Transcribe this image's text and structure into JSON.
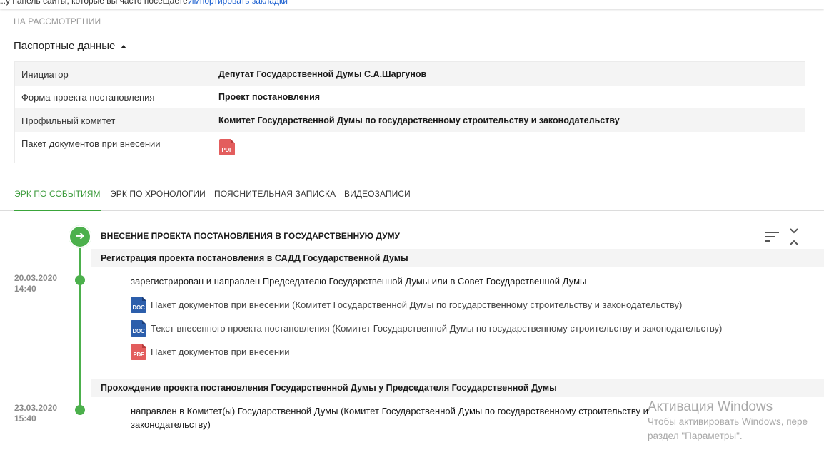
{
  "browser": {
    "bookmarks_hint": "...у панель сайты, которые вы часто посещаете.",
    "import_bookmarks_link": "Импортировать закладки"
  },
  "status_label": "НА РАССМОТРЕНИИ",
  "passport": {
    "toggle_label": "Паспортные данные",
    "rows": [
      {
        "label": "Инициатор",
        "value": "Депутат Государственной Думы С.А.Шаргунов"
      },
      {
        "label": "Форма проекта постановления",
        "value": "Проект постановления"
      },
      {
        "label": "Профильный комитет",
        "value": "Комитет Государственной Думы по государственному строительству и законодательству"
      },
      {
        "label": "Пакет документов при внесении",
        "icon": "pdf-icon"
      }
    ]
  },
  "icon_labels": {
    "pdf": "PDF",
    "doc": "DOC"
  },
  "tabs": [
    {
      "label": "ЭРК по событиям",
      "active": true
    },
    {
      "label": "ЭРК по хронологии",
      "active": false
    },
    {
      "label": "Пояснительная записка",
      "active": false
    },
    {
      "label": "Видеозаписи",
      "active": false
    }
  ],
  "timeline": {
    "stage_title": "Внесение проекта постановления в Государственную Думу",
    "events": [
      {
        "header": "Регистрация проекта постановления в САДД Государственной Думы",
        "date": "20.03.2020",
        "time": "14:40",
        "text": "зарегистрирован и направлен Председателю Государственной Думы или в Совет Государственной Думы",
        "documents": [
          {
            "type": "doc",
            "label": "Пакет документов при внесении (Комитет Государственной Думы по государственному строительству и законодательству)"
          },
          {
            "type": "doc",
            "label": "Текст внесенного проекта постановления (Комитет Государственной Думы по государственному строительству и законодательству)"
          },
          {
            "type": "pdf",
            "label": "Пакет документов при внесении"
          }
        ]
      },
      {
        "header": "Прохождение проекта постановления Государственной Думы у Председателя Государственной Думы",
        "date": "23.03.2020",
        "time": "15:40",
        "text_line1": "направлен в Комитет(ы) Государственной Думы (Комитет Государственной Думы по государственному строительству и",
        "text_line2": "законодательству)"
      }
    ]
  },
  "windows_watermark": {
    "title": "Активация Windows",
    "line1": "Чтобы активировать Windows, пере",
    "line2": "раздел \"Параметры\"."
  },
  "colors": {
    "accent_green": "#4cb04c",
    "tab_active": "#3a9a3a",
    "doc_blue": "#2c5eab",
    "pdf_red": "#e35d5d"
  }
}
